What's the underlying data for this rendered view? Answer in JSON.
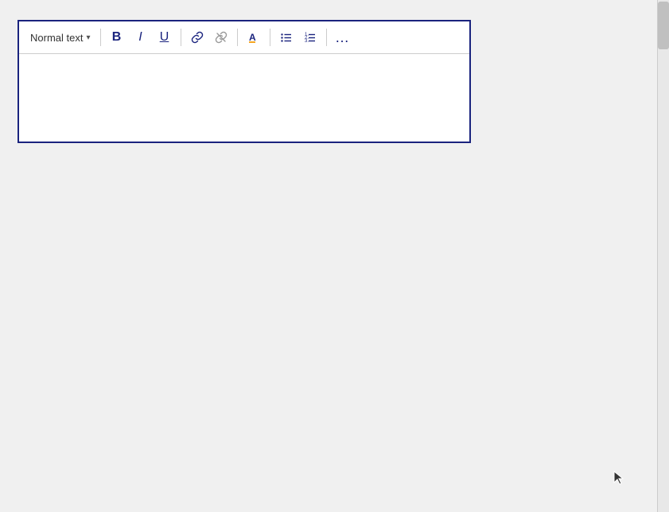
{
  "toolbar": {
    "text_style_label": "Normal text",
    "dropdown_arrow": "▾",
    "bold_label": "B",
    "italic_label": "I",
    "underline_label": "U",
    "link_label": "🔗",
    "unlink_label": "🔗",
    "highlight_label": "A",
    "unordered_list_label": "≡",
    "ordered_list_label": "☷",
    "more_label": "…"
  },
  "editor": {
    "placeholder": "",
    "content": ""
  },
  "background": "#f0f0f0",
  "accent_color": "#1a237e"
}
